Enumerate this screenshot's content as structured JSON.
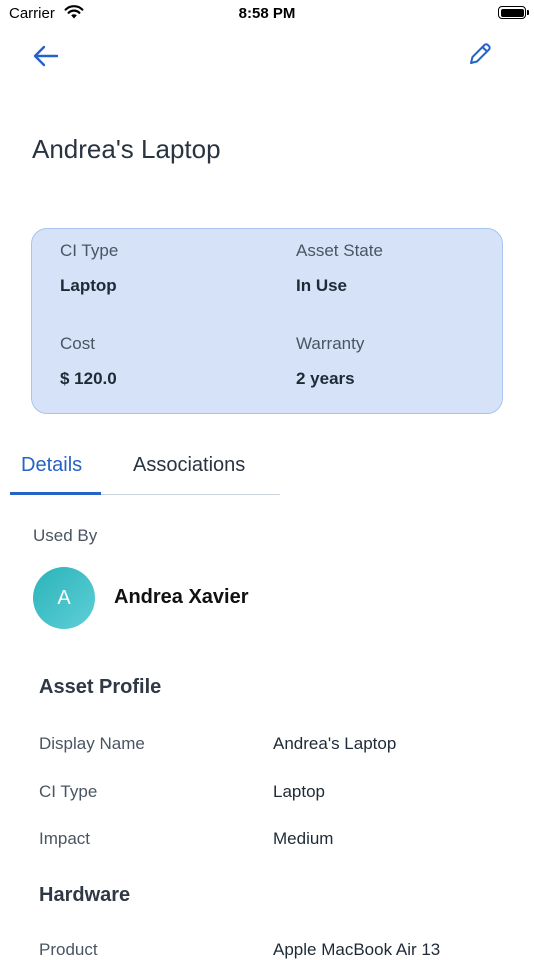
{
  "status_bar": {
    "carrier": "Carrier",
    "time": "8:58 PM"
  },
  "nav": {
    "back_icon": "arrow-left-icon",
    "edit_icon": "pencil-icon",
    "accent": "#2563c7"
  },
  "page": {
    "title": "Andrea's Laptop"
  },
  "summary": {
    "ci_type_label": "CI Type",
    "ci_type_value": "Laptop",
    "asset_state_label": "Asset State",
    "asset_state_value": "In Use",
    "cost_label": "Cost",
    "cost_value": "$ 120.0",
    "warranty_label": "Warranty",
    "warranty_value": "2 years",
    "card_color": "#d6e2f7"
  },
  "tabs": [
    {
      "label": "Details",
      "selected": true
    },
    {
      "label": "Associations",
      "selected": false
    }
  ],
  "used_by": {
    "label": "Used By",
    "initial": "A",
    "name": "Andrea Xavier"
  },
  "asset_profile": {
    "title": "Asset Profile",
    "rows": [
      {
        "label": "Display Name",
        "value": "Andrea's Laptop"
      },
      {
        "label": "CI Type",
        "value": "Laptop"
      },
      {
        "label": "Impact",
        "value": "Medium"
      }
    ]
  },
  "hardware": {
    "title": "Hardware",
    "rows": [
      {
        "label": "Product",
        "value": "Apple MacBook Air 13"
      }
    ]
  }
}
